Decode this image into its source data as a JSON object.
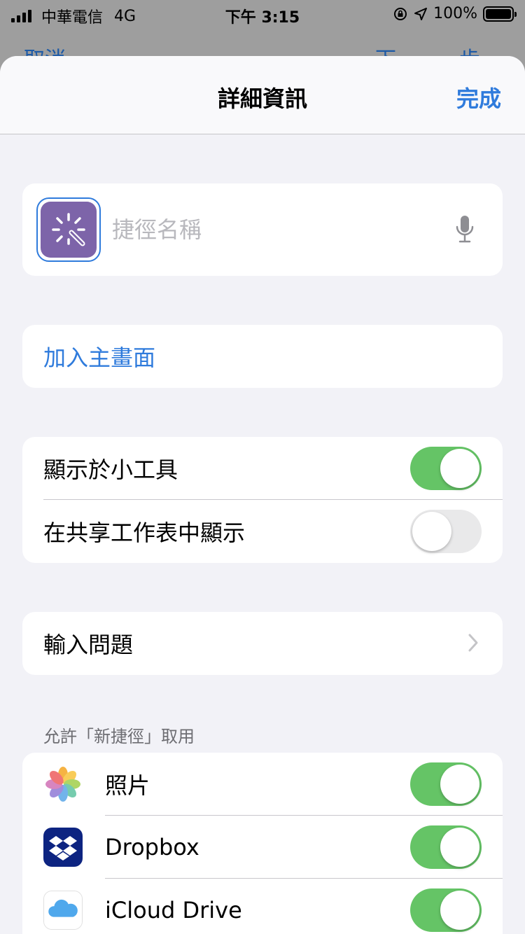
{
  "status_bar": {
    "carrier": "中華電信",
    "network": "4G",
    "time": "下午 3:15",
    "battery": "100%"
  },
  "behind": {
    "left": "取消",
    "right": "下一步"
  },
  "nav": {
    "title": "詳細資訊",
    "done": "完成"
  },
  "name_card": {
    "placeholder": "捷徑名稱",
    "value": ""
  },
  "add_home": {
    "label": "加入主畫面"
  },
  "toggles": [
    {
      "label": "顯示於小工具",
      "on": true
    },
    {
      "label": "在共享工作表中顯示",
      "on": false
    }
  ],
  "input_question": {
    "label": "輸入問題"
  },
  "access_section": {
    "header": "允許「新捷徑」取用",
    "apps": [
      {
        "label": "照片",
        "icon": "photos-icon",
        "on": true
      },
      {
        "label": "Dropbox",
        "icon": "dropbox-icon",
        "on": true
      },
      {
        "label": "iCloud Drive",
        "icon": "icloud-icon",
        "on": true
      }
    ]
  },
  "colors": {
    "accent": "#2f7bdc",
    "toggle_on": "#65c466",
    "toggle_off": "#e9e9ea",
    "shortcut_icon": "#7d64a9",
    "dropbox": "#0d2481"
  }
}
